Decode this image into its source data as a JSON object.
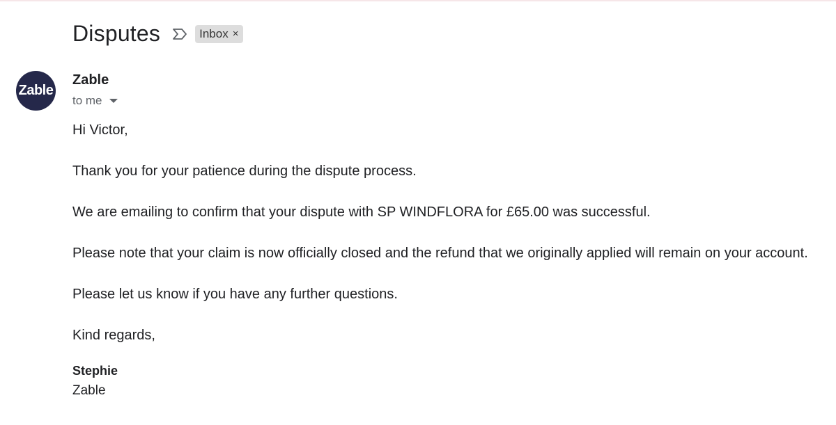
{
  "subject": {
    "title": "Disputes",
    "label": "Inbox",
    "label_remove": "×"
  },
  "sender": {
    "avatar_text": "Zable",
    "name": "Zable",
    "recipient": "to me"
  },
  "body": {
    "greeting": "Hi Victor,",
    "lines": [
      "Thank you for your patience during the dispute process.",
      "We are emailing to confirm that your dispute with SP WINDFLORA for £65.00 was successful.",
      "Please note that your claim is now officially closed and the refund that we originally applied will remain on your account.",
      "Please let us know if you have any further questions.",
      "Kind regards,"
    ],
    "signature_name": "Stephie",
    "signature_company": "Zable"
  },
  "icons": {
    "importance": "importance-marker-icon",
    "dropdown": "chevron-down-icon"
  },
  "colors": {
    "avatar_bg": "#25284a",
    "chip_bg": "#dddddd"
  }
}
